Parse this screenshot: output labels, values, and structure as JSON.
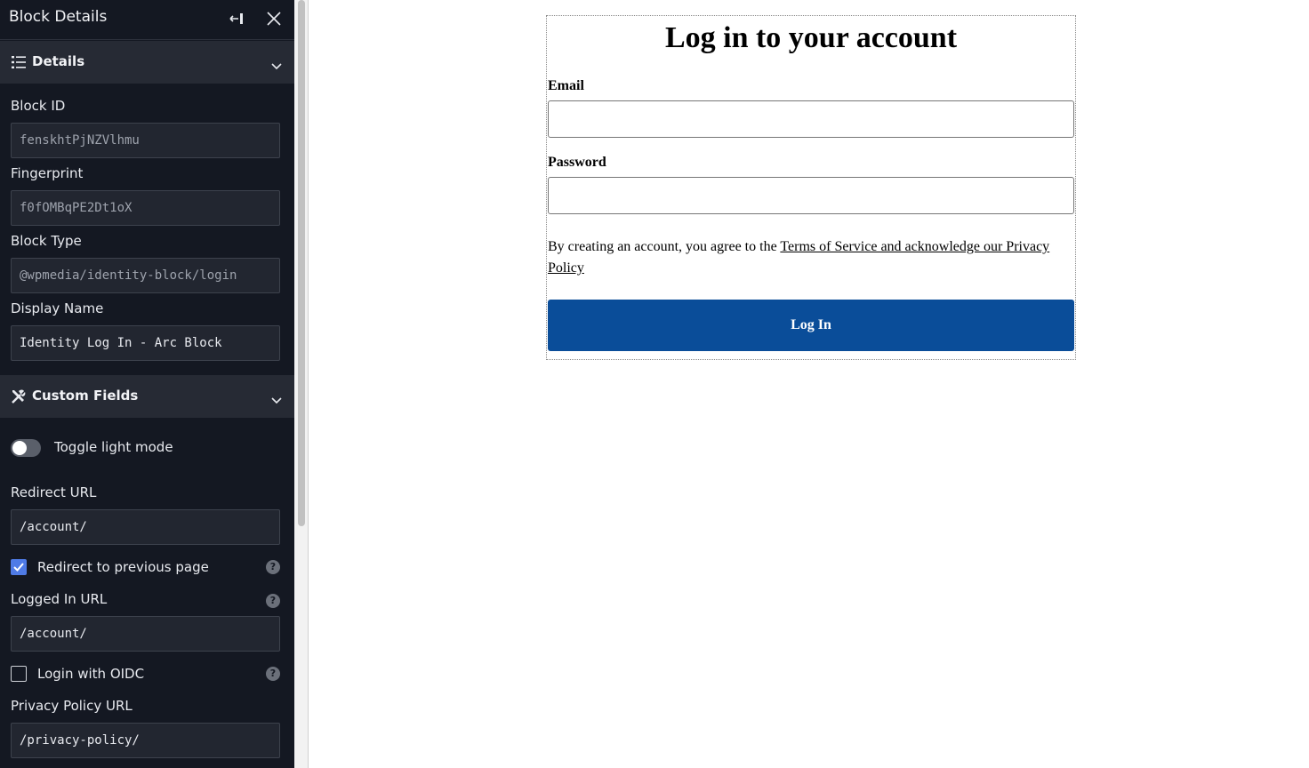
{
  "panel": {
    "title": "Block Details"
  },
  "details_section": {
    "title": "Details",
    "block_id_label": "Block ID",
    "block_id_value": "fenskhtPjNZVlhmu",
    "fingerprint_label": "Fingerprint",
    "fingerprint_value": "f0fOMBqPE2Dt1oX",
    "block_type_label": "Block Type",
    "block_type_value": "@wpmedia/identity-block/login",
    "display_name_label": "Display Name",
    "display_name_value": "Identity Log In - Arc Block"
  },
  "custom_fields_section": {
    "title": "Custom Fields",
    "toggle_light_mode_label": "Toggle light mode",
    "toggle_light_mode_on": false,
    "redirect_url_label": "Redirect URL",
    "redirect_url_value": "/account/",
    "redirect_previous_label": "Redirect to previous page",
    "redirect_previous_checked": true,
    "logged_in_url_label": "Logged In URL",
    "logged_in_url_value": "/account/",
    "login_oidc_label": "Login with OIDC",
    "login_oidc_checked": false,
    "privacy_policy_url_label": "Privacy Policy URL",
    "privacy_policy_url_value": "/privacy-policy/",
    "help_symbol": "?"
  },
  "icons": {
    "header": [
      "collapse-panel-icon",
      "close-icon"
    ],
    "details": "list-icon",
    "custom_fields": "tools-icon",
    "section_toggle": "chevron-down-icon"
  },
  "login_form": {
    "title": "Log in to your account",
    "email_label": "Email",
    "password_label": "Password",
    "legal_prefix": "By creating an account, you agree to the ",
    "legal_link": "Terms of Service and acknowledge our Privacy Policy",
    "submit_label": "Log In"
  },
  "colors": {
    "sidebar_bg": "#141822",
    "section_bg": "#262a34",
    "checkbox_accent": "#4f7be6",
    "submit_button": "#0a4d99"
  }
}
